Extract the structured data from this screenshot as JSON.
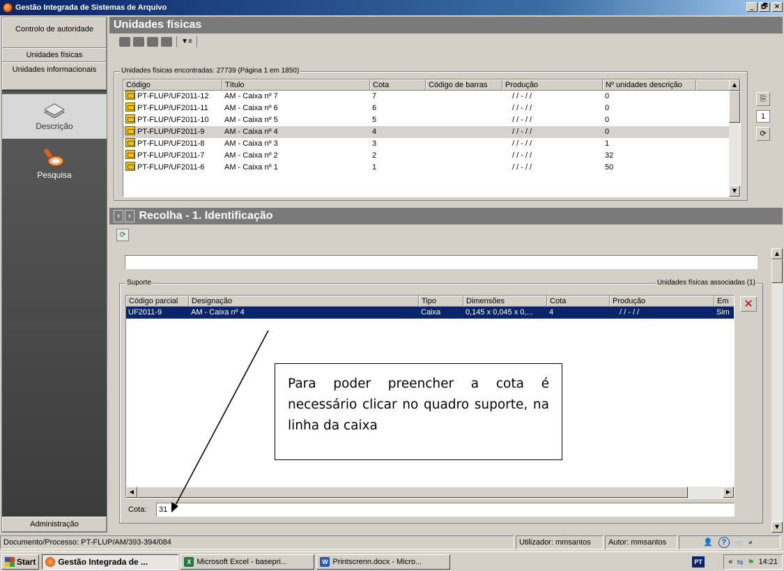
{
  "window": {
    "title": "Gestão Integrada de Sistemas de Arquivo",
    "min": "_",
    "max": "🗗",
    "close": "×"
  },
  "sidebar": {
    "controlo": "Controlo de autoridade",
    "unidades_fisicas": "Unidades físicas",
    "unidades_informacionais": "Unidades informacionais",
    "descricao": "Descrição",
    "pesquisa": "Pesquisa",
    "administracao": "Administração"
  },
  "top": {
    "header": "Unidades físicas",
    "group_title": "Unidades físicas encontradas: 27739 (Página 1 em 1850)",
    "columns": [
      "Código",
      "Título",
      "Cota",
      "Código de barras",
      "Produção",
      "Nº unidades descrição"
    ],
    "rows": [
      {
        "codigo": "PT-FLUP/UF2011-12",
        "titulo": "AM - Caixa nº 7",
        "cota": "7",
        "barras": "",
        "producao": "/ /  -  / /",
        "n": "0"
      },
      {
        "codigo": "PT-FLUP/UF2011-11",
        "titulo": "AM - Caixa nº 6",
        "cota": "6",
        "barras": "",
        "producao": "/ /  -  / /",
        "n": "0"
      },
      {
        "codigo": "PT-FLUP/UF2011-10",
        "titulo": "AM - Caixa nº 5",
        "cota": "5",
        "barras": "",
        "producao": "/ /  -  / /",
        "n": "0"
      },
      {
        "codigo": "PT-FLUP/UF2011-9",
        "titulo": "AM - Caixa nº 4",
        "cota": "4",
        "barras": "",
        "producao": "/ /  -  / /",
        "n": "0"
      },
      {
        "codigo": "PT-FLUP/UF2011-8",
        "titulo": "AM - Caixa nº 3",
        "cota": "3",
        "barras": "",
        "producao": "/ /  -  / /",
        "n": "1"
      },
      {
        "codigo": "PT-FLUP/UF2011-7",
        "titulo": "AM - Caixa nº 2",
        "cota": "2",
        "barras": "",
        "producao": "/ /  -  / /",
        "n": "32"
      },
      {
        "codigo": "PT-FLUP/UF2011-6",
        "titulo": "AM - Caixa nº 1",
        "cota": "1",
        "barras": "",
        "producao": "/ /  -  / /",
        "n": "50"
      }
    ],
    "page": "1"
  },
  "bottom": {
    "header": "Recolha - 1. Identificação",
    "suporte_title": "Suporte",
    "associadas": "Unidades físicas associadas (1)",
    "columns": [
      "Código parcial",
      "Designação",
      "Tipo",
      "Dimensões",
      "Cota",
      "Produção",
      "Em"
    ],
    "row": {
      "codigo": "UF2011-9",
      "designacao": "AM - Caixa nº 4",
      "tipo": "Caixa",
      "dimensoes": "0,145 x 0,045 x 0,...",
      "cota": "4",
      "producao": "/ /  -  / /",
      "em": "Sim"
    },
    "cota_label": "Cota:",
    "cota_value": "31"
  },
  "callout": "Para poder preencher a cota é necessário clicar no quadro suporte, na linha da caixa",
  "status": {
    "doc": "Documento/Processo: PT-FLUP/AM/393-394/084",
    "utilizador": "Utilizador: mmsantos",
    "autor": "Autor: mmsantos"
  },
  "taskbar": {
    "start": "Start",
    "items": [
      "Gestão Integrada de ...",
      "Microsoft Excel - basepri...",
      "Printscrenn.docx - Micro..."
    ],
    "lang": "PT",
    "time": "14:21"
  }
}
